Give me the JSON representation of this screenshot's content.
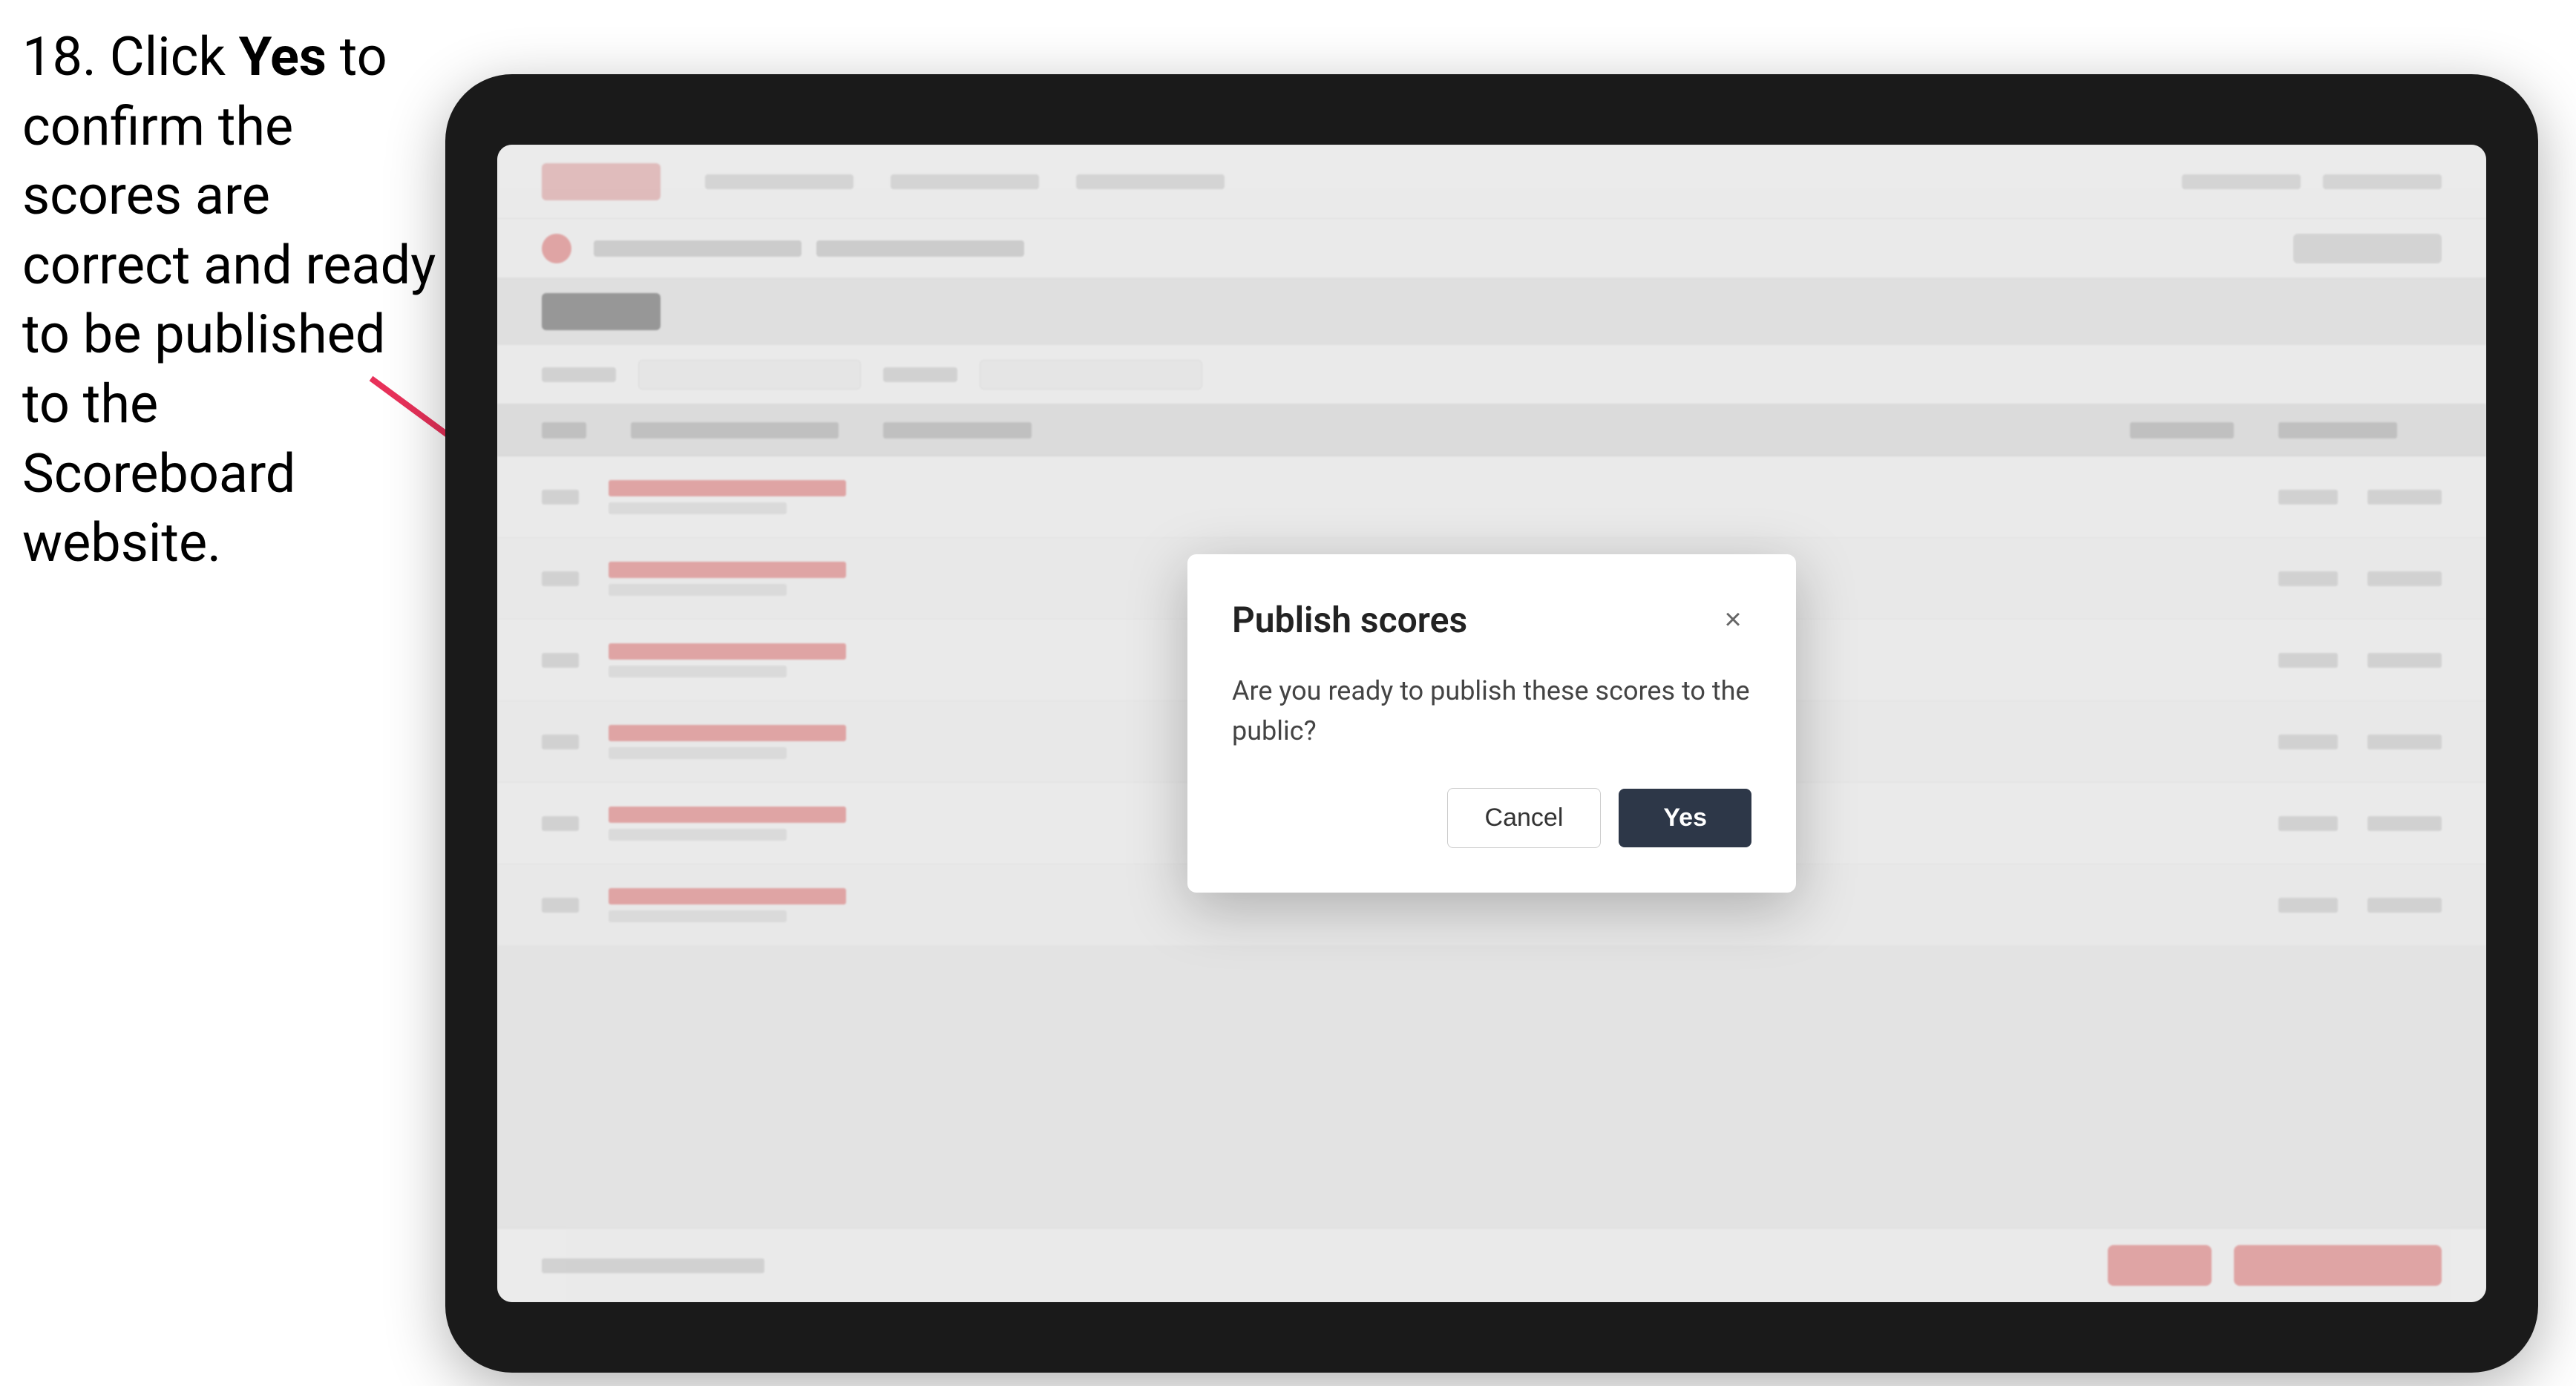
{
  "instruction": {
    "step": "18.",
    "text_before_bold": " Click ",
    "bold_word": "Yes",
    "text_after_bold": " to confirm the scores are correct and ready to be published to the Scoreboard website."
  },
  "tablet": {
    "screen": {
      "nav": {
        "logo_alt": "Logo"
      },
      "breadcrumb": {
        "label": "Event breadcrumb"
      }
    },
    "modal": {
      "title": "Publish scores",
      "body": "Are you ready to publish these scores to the public?",
      "cancel_label": "Cancel",
      "yes_label": "Yes",
      "close_icon": "×"
    }
  },
  "arrow": {
    "color": "#e8315a"
  }
}
